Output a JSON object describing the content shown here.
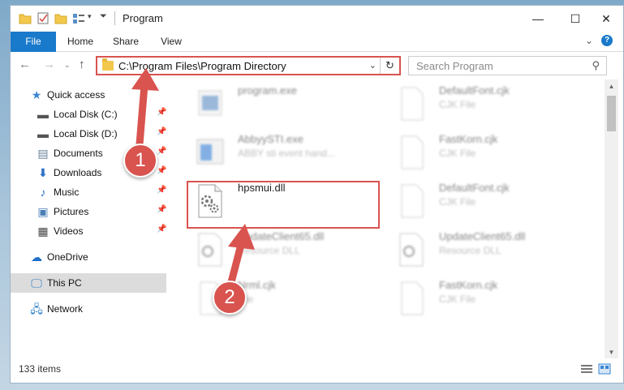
{
  "window": {
    "title": "Program"
  },
  "ribbon": {
    "tabs": [
      "File",
      "Home",
      "Share",
      "View"
    ]
  },
  "nav": {
    "address": "C:\\Program Files\\Program Directory",
    "search_placeholder": "Search Program"
  },
  "sidebar": {
    "items": [
      {
        "label": "Quick access",
        "icon": "star-icon"
      },
      {
        "label": "Local Disk (C:)",
        "icon": "drive-icon",
        "pinned": true
      },
      {
        "label": "Local Disk (D:)",
        "icon": "drive-icon",
        "pinned": true
      },
      {
        "label": "Documents",
        "icon": "document-icon",
        "pinned": true
      },
      {
        "label": "Downloads",
        "icon": "download-icon",
        "pinned": true
      },
      {
        "label": "Music",
        "icon": "music-icon",
        "pinned": true
      },
      {
        "label": "Pictures",
        "icon": "picture-icon",
        "pinned": true
      },
      {
        "label": "Videos",
        "icon": "video-icon",
        "pinned": true
      },
      {
        "label": "OneDrive",
        "icon": "cloud-icon"
      },
      {
        "label": "This PC",
        "icon": "computer-icon",
        "selected": true
      },
      {
        "label": "Network",
        "icon": "network-icon"
      }
    ]
  },
  "files": [
    {
      "name": "program.exe",
      "sub": "",
      "blurred": true
    },
    {
      "name": "DefaultFont.cjk",
      "sub": "CJK File",
      "blurred": true
    },
    {
      "name": "AbbyySTI.exe",
      "sub": "ABBY sti event hand...",
      "blurred": true
    },
    {
      "name": "FastKorn.cjk",
      "sub": "CJK File",
      "blurred": true
    },
    {
      "name": "hpsmui.dll",
      "sub": "",
      "blurred": false
    },
    {
      "name": "DefaultFont.cjk",
      "sub": "CJK File",
      "blurred": true
    },
    {
      "name": "UpdateClient65.dll",
      "sub": "Resource DLL",
      "blurred": true
    },
    {
      "name": "UpdateClient65.dll",
      "sub": "Resource DLL",
      "blurred": true
    },
    {
      "name": "Nrml.cjk",
      "sub": "File",
      "blurred": true
    },
    {
      "name": "FastKorn.cjk",
      "sub": "CJK File",
      "blurred": true
    }
  ],
  "status": {
    "items_count": "133 items"
  },
  "annotations": {
    "step1": "1",
    "step2": "2",
    "color": "#d9534f"
  }
}
